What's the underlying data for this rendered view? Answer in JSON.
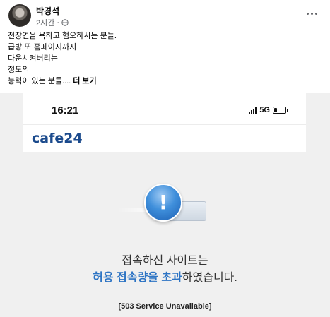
{
  "post": {
    "author": "박경석",
    "time": "2시간",
    "time_separator": "·",
    "audience_icon": "globe-icon",
    "lines": [
      "전장연을 욕하고 혐오하시는 분들.",
      "급방 또 홈페이지까지",
      "다운시켜버리는",
      "정도의",
      "능력이 있는 분들...."
    ],
    "see_more": "더 보기",
    "more_icon": "more-horizontal-icon"
  },
  "screenshot": {
    "time": "16:21",
    "network": "5G",
    "logo": "cafe24",
    "message_line1": "접속하신 사이트는",
    "message_line2_highlight": "허용 접속량을 초과",
    "message_line2_rest": "하였습니다.",
    "error_code": "[503 Service Unavailable]",
    "colors": {
      "logo": "#1b4a8c",
      "highlight": "#2d74c4",
      "background": "#f0f0f0"
    }
  }
}
